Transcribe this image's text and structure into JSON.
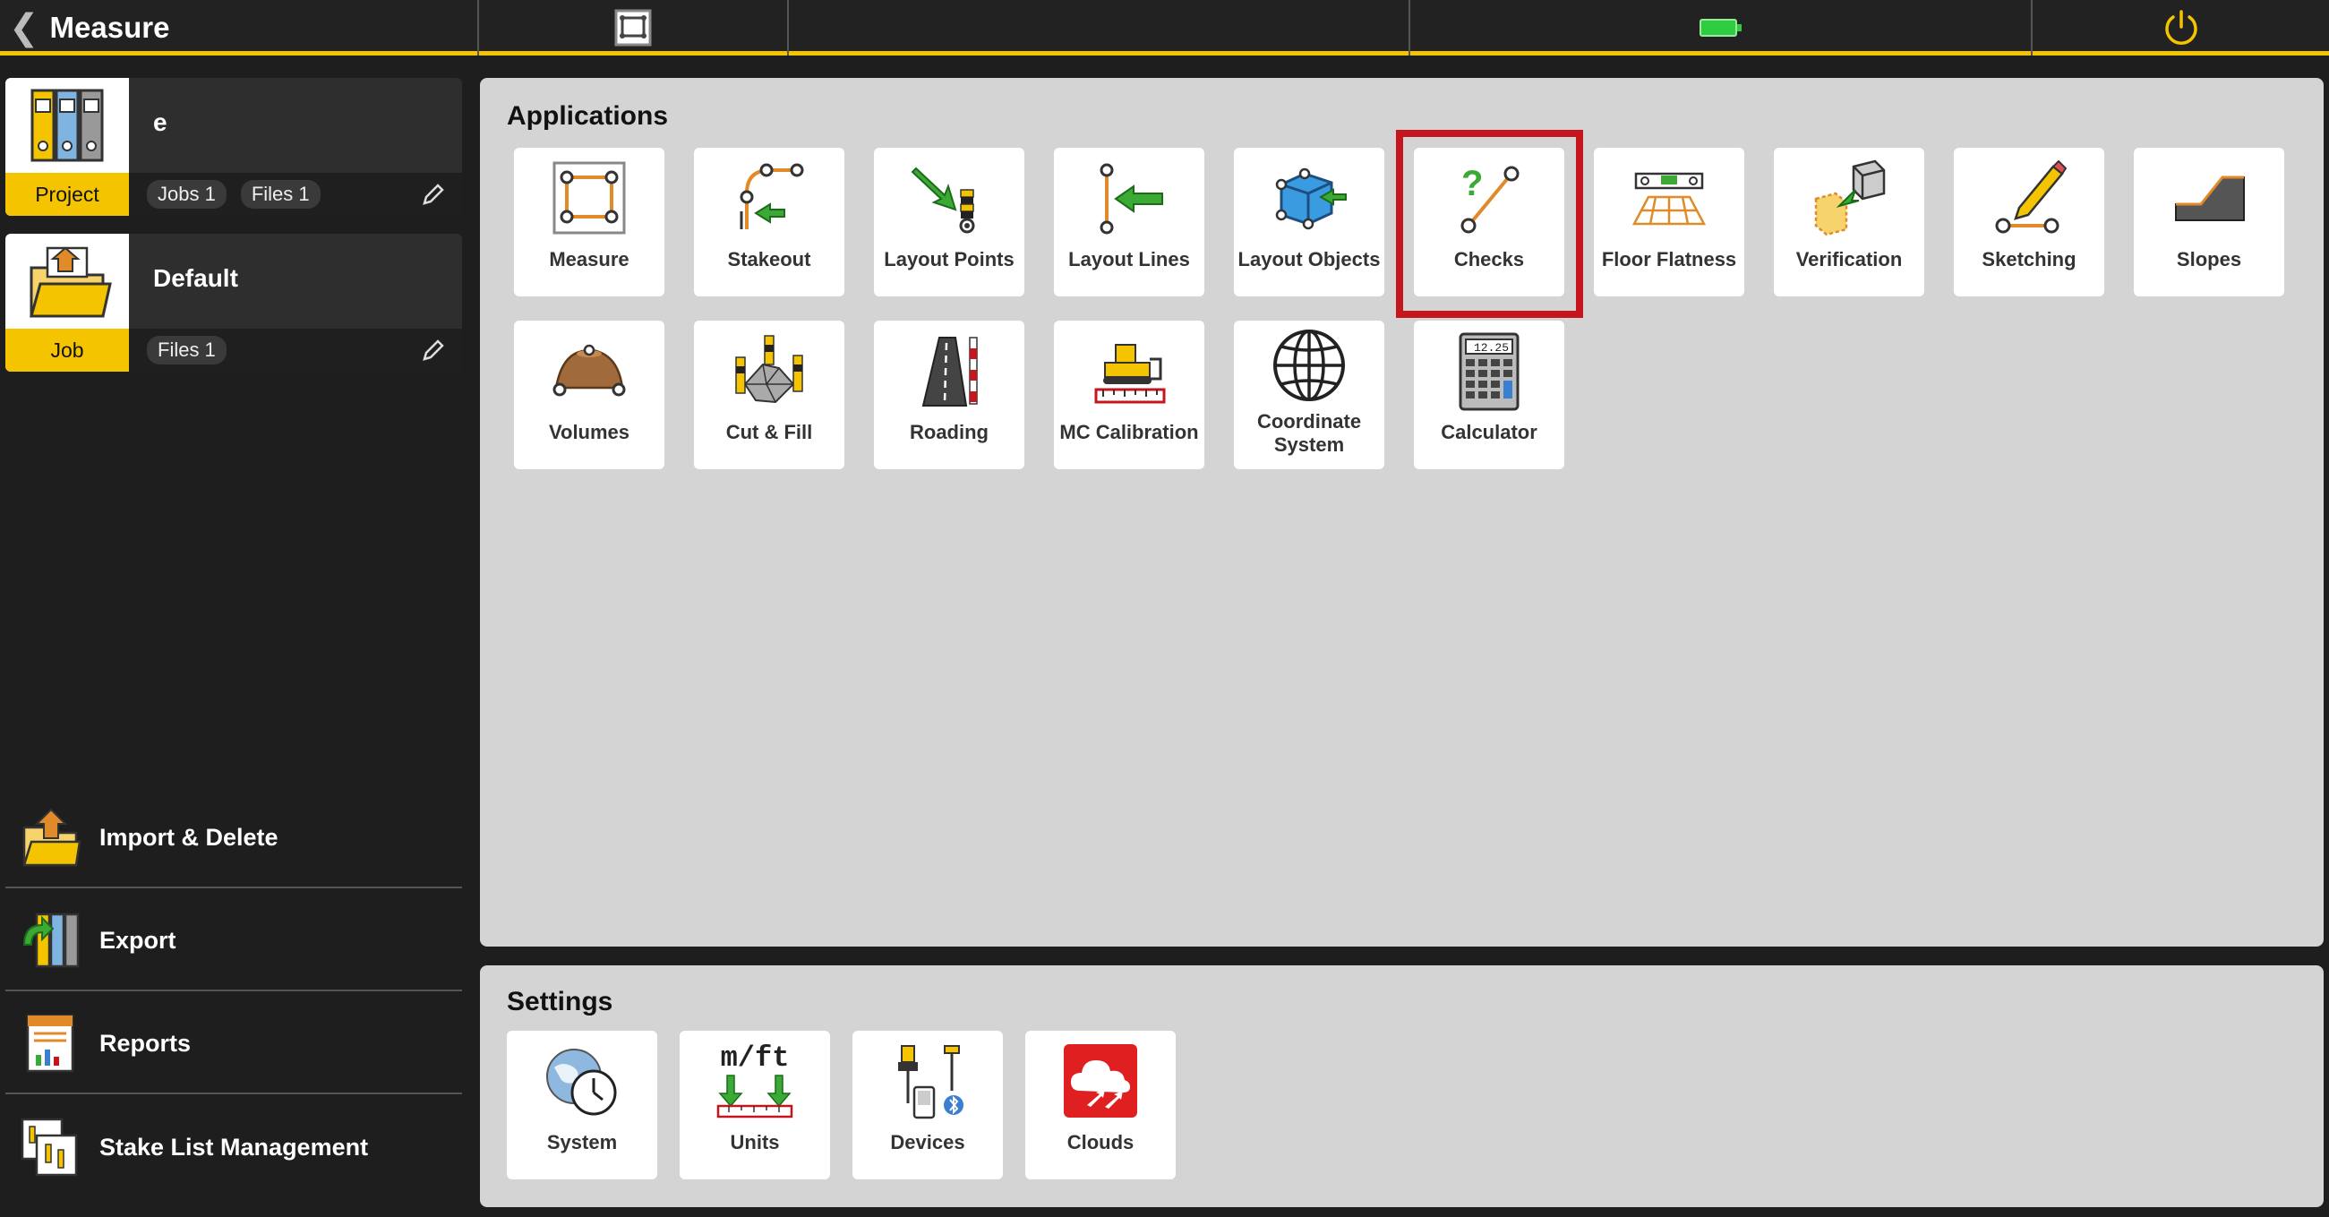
{
  "topbar": {
    "title": "Measure",
    "colors": {
      "accent": "#f4c400",
      "battery": "#2ecc40",
      "power": "#f4c400"
    }
  },
  "project_card": {
    "name": "e",
    "label": "Project",
    "jobs": "Jobs 1",
    "files": "Files 1"
  },
  "job_card": {
    "name": "Default",
    "label": "Job",
    "files": "Files 1"
  },
  "side_menu": [
    {
      "label": "Import & Delete"
    },
    {
      "label": "Export"
    },
    {
      "label": "Reports"
    },
    {
      "label": "Stake List Management"
    }
  ],
  "applications": {
    "title": "Applications",
    "tiles": [
      {
        "label": "Measure"
      },
      {
        "label": "Stakeout"
      },
      {
        "label": "Layout Points"
      },
      {
        "label": "Layout Lines"
      },
      {
        "label": "Layout Objects"
      },
      {
        "label": "Checks"
      },
      {
        "label": "Floor Flatness"
      },
      {
        "label": "Verification"
      },
      {
        "label": "Sketching"
      },
      {
        "label": "Slopes"
      },
      {
        "label": "Volumes"
      },
      {
        "label": "Cut & Fill"
      },
      {
        "label": "Roading"
      },
      {
        "label": "MC Calibration"
      },
      {
        "label": "Coordinate System"
      },
      {
        "label": "Calculator"
      }
    ],
    "highlight_color": "#c4161c"
  },
  "settings": {
    "title": "Settings",
    "tiles": [
      {
        "label": "System"
      },
      {
        "label": "Units"
      },
      {
        "label": "Devices"
      },
      {
        "label": "Clouds"
      }
    ],
    "units_icon_text": "m/ft",
    "calculator_display": "12.25"
  }
}
